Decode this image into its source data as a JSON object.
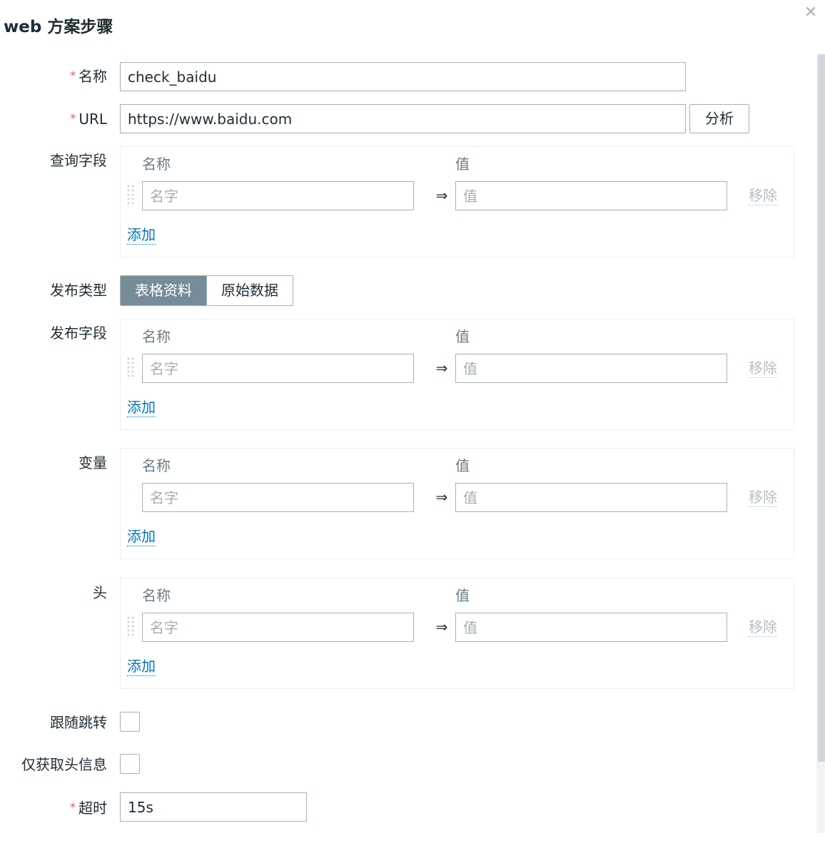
{
  "dialog": {
    "title": "web 方案步骤",
    "close_icon": "close-icon"
  },
  "form": {
    "name": {
      "label": "名称",
      "value": "check_baidu"
    },
    "url": {
      "label": "URL",
      "value": "https://www.baidu.com",
      "parse_button": "分析"
    },
    "query_fields": {
      "label": "查询字段",
      "col_name": "名称",
      "col_value": "值",
      "name_placeholder": "名字",
      "value_placeholder": "值",
      "arrow": "⇒",
      "remove": "移除",
      "add": "添加"
    },
    "post_type": {
      "label": "发布类型",
      "options": [
        "表格资料",
        "原始数据"
      ],
      "selected": "表格资料"
    },
    "post_fields": {
      "label": "发布字段",
      "col_name": "名称",
      "col_value": "值",
      "name_placeholder": "名字",
      "value_placeholder": "值",
      "arrow": "⇒",
      "remove": "移除",
      "add": "添加"
    },
    "variables": {
      "label": "变量",
      "col_name": "名称",
      "col_value": "值",
      "name_placeholder": "名字",
      "value_placeholder": "值",
      "arrow": "⇒",
      "remove": "移除",
      "add": "添加"
    },
    "headers": {
      "label": "头",
      "col_name": "名称",
      "col_value": "值",
      "name_placeholder": "名字",
      "value_placeholder": "值",
      "arrow": "⇒",
      "remove": "移除",
      "add": "添加"
    },
    "follow_redirects": {
      "label": "跟随跳转",
      "checked": false
    },
    "retrieve_headers_only": {
      "label": "仅获取头信息",
      "checked": false
    },
    "timeout": {
      "label": "超时",
      "value": "15s"
    },
    "required_marker": "*"
  },
  "colors": {
    "accent": "#768d99",
    "link": "#0275b8",
    "required": "#e45959"
  }
}
